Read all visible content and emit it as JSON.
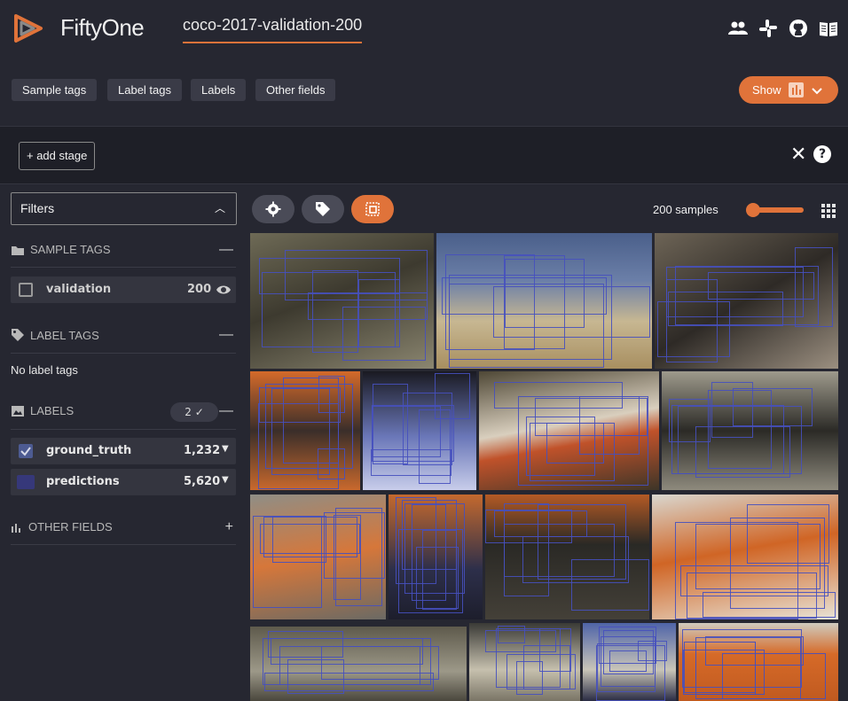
{
  "header": {
    "brand": "FiftyOne",
    "dataset_name": "coco-2017-validation-200",
    "icons": [
      "people-icon",
      "slack-icon",
      "github-icon",
      "docs-book-icon"
    ]
  },
  "field_tabs": [
    "Sample tags",
    "Label tags",
    "Labels",
    "Other fields"
  ],
  "show_button": {
    "label": "Show"
  },
  "view_bar": {
    "add_stage_label": "+ add stage"
  },
  "sidebar": {
    "filters_label": "Filters",
    "sample_tags": {
      "title": "SAMPLE TAGS",
      "items": [
        {
          "label": "validation",
          "count": "200"
        }
      ]
    },
    "label_tags": {
      "title": "LABEL TAGS",
      "empty_text": "No label tags"
    },
    "labels": {
      "title": "LABELS",
      "badge": "2",
      "items": [
        {
          "label": "ground_truth",
          "count": "1,232",
          "color": "#4d5b92",
          "checked": true
        },
        {
          "label": "predictions",
          "count": "5,620",
          "color": "#36387a",
          "checked": false
        }
      ]
    },
    "other_fields": {
      "title": "OTHER FIELDS"
    }
  },
  "grid": {
    "samples_label": "200 samples"
  },
  "colors": {
    "accent": "#e0733a",
    "background": "#262731",
    "panel": "#34353f",
    "box": "#4650be"
  }
}
